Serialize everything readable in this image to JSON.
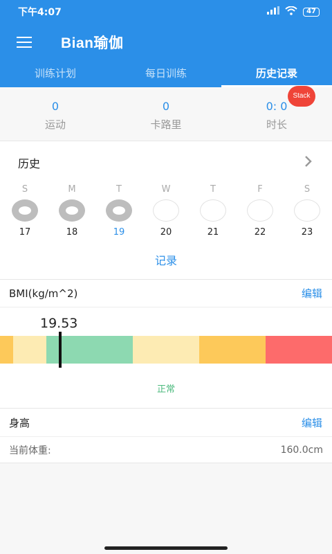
{
  "status_bar": {
    "time": "下午4:07",
    "battery": "47"
  },
  "header": {
    "title": "Bian瑜伽"
  },
  "tabs": [
    {
      "label": "训练计划",
      "active": false
    },
    {
      "label": "每日训练",
      "active": false
    },
    {
      "label": "历史记录",
      "active": true
    }
  ],
  "stats": [
    {
      "value": "0",
      "label": "运动"
    },
    {
      "value": "0",
      "label": "卡路里"
    },
    {
      "value": "0: 0",
      "label": "时长"
    }
  ],
  "stack_badge": "Stack",
  "history": {
    "title": "历史",
    "days": [
      {
        "letter": "S",
        "num": "17",
        "done": true
      },
      {
        "letter": "M",
        "num": "18",
        "done": true
      },
      {
        "letter": "T",
        "num": "19",
        "done": true,
        "today": true
      },
      {
        "letter": "W",
        "num": "20",
        "done": false
      },
      {
        "letter": "T",
        "num": "21",
        "done": false
      },
      {
        "letter": "F",
        "num": "22",
        "done": false
      },
      {
        "letter": "S",
        "num": "23",
        "done": false
      }
    ],
    "record_label": "记录"
  },
  "bmi": {
    "label": "BMI(kg/m^2)",
    "edit": "编辑",
    "value": "19.53",
    "status": "正常",
    "segments": [
      {
        "color": "#fdc95a",
        "fraction": 0.04
      },
      {
        "color": "#fdebb3",
        "fraction": 0.1
      },
      {
        "color": "#8dd9b1",
        "fraction": 0.26
      },
      {
        "color": "#fdebb3",
        "fraction": 0.2
      },
      {
        "color": "#fdc95a",
        "fraction": 0.2
      },
      {
        "color": "#fd6b6b",
        "fraction": 0.2
      }
    ]
  },
  "height": {
    "label": "身高",
    "edit": "编辑",
    "current_label": "当前体重:",
    "current_value": "160.0cm"
  },
  "colors": {
    "primary": "#2b8fe8",
    "badge": "#ef4438",
    "normal": "#4cba7e"
  }
}
